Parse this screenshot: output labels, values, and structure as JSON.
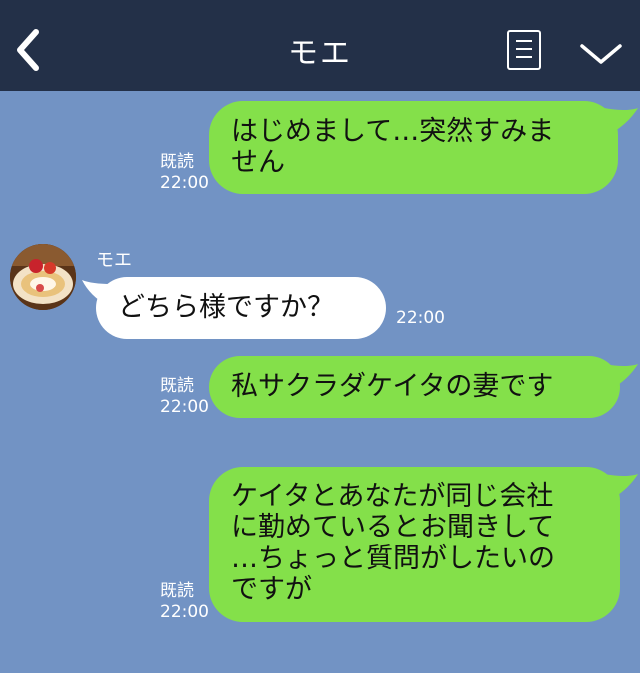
{
  "header": {
    "title": "モエ"
  },
  "messages": [
    {
      "text": "はじめまして…突然すみま\nせん",
      "read": "既読",
      "time": "22:00"
    },
    {
      "sender": "モエ",
      "text": "どちら様ですか？",
      "time": "22:00"
    },
    {
      "text": "私サクラダケイタの妻です",
      "read": "既読",
      "time": "22:00"
    },
    {
      "text": "ケイタとあなたが同じ会社\nに勤めているとお聞きして\n…ちょっと質問がしたいの\nですが",
      "read": "既読",
      "time": "22:00"
    }
  ],
  "colors": {
    "header": "#233048",
    "background": "#7293c4",
    "outgoing_bubble": "#84e04a",
    "incoming_bubble": "#ffffff"
  },
  "icons": [
    "back-chevron-icon",
    "menu-icon",
    "chevron-down-icon",
    "avatar-cake-image"
  ]
}
